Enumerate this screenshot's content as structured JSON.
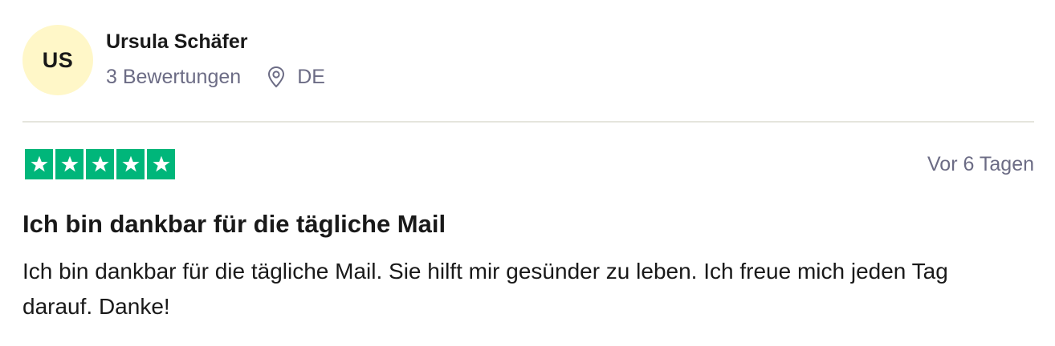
{
  "reviewer": {
    "initials": "US",
    "name": "Ursula Schäfer",
    "review_count": "3 Bewertungen",
    "country": "DE",
    "avatar_color": "#fff7c8"
  },
  "review": {
    "rating": 5,
    "max_rating": 5,
    "star_color": "#00b67a",
    "date": "Vor 6 Tagen",
    "title": "Ich bin dankbar für die tägliche Mail",
    "body": "Ich bin dankbar für die tägliche Mail. Sie hilft mir gesünder zu leben. Ich freue mich jeden Tag darauf. Danke!"
  },
  "icons": {
    "location": "map-pin-icon",
    "star": "star-icon"
  }
}
